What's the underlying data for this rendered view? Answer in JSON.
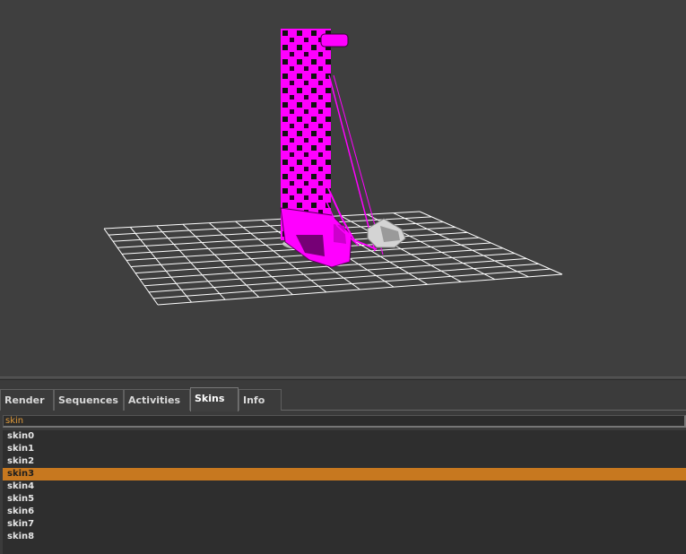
{
  "viewport": {
    "background": "#3f3f3f",
    "model_color": "#ff00ff",
    "grid_color": "#ffffff"
  },
  "tabs": [
    {
      "label": "Render",
      "active": false
    },
    {
      "label": "Sequences",
      "active": false
    },
    {
      "label": "Activities",
      "active": false
    },
    {
      "label": "Skins",
      "active": true
    },
    {
      "label": "Info",
      "active": false
    }
  ],
  "filter": {
    "value": "skin"
  },
  "skins": {
    "items": [
      "skin0",
      "skin1",
      "skin2",
      "skin3",
      "skin4",
      "skin5",
      "skin6",
      "skin7",
      "skin8"
    ],
    "selected": "skin3",
    "selected_color": "#c7781f"
  }
}
